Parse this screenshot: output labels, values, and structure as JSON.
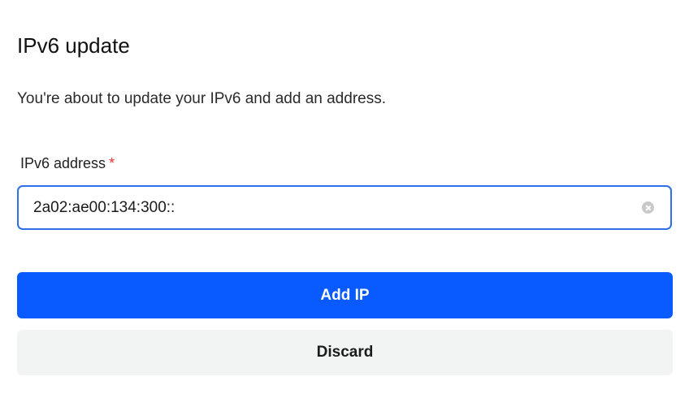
{
  "dialog": {
    "title": "IPv6 update",
    "description": "You're about to update your IPv6 and add an address."
  },
  "form": {
    "address_label": "IPv6 address",
    "required_mark": "*",
    "address_value": "2a02:ae00:134:300::",
    "clear_icon": "clear-circle-x-icon"
  },
  "actions": {
    "add_label": "Add IP",
    "discard_label": "Discard"
  },
  "colors": {
    "primary": "#0a5bff",
    "focus_border": "#2f6fe8",
    "required": "#e5322d",
    "secondary_bg": "#f2f3f3"
  }
}
